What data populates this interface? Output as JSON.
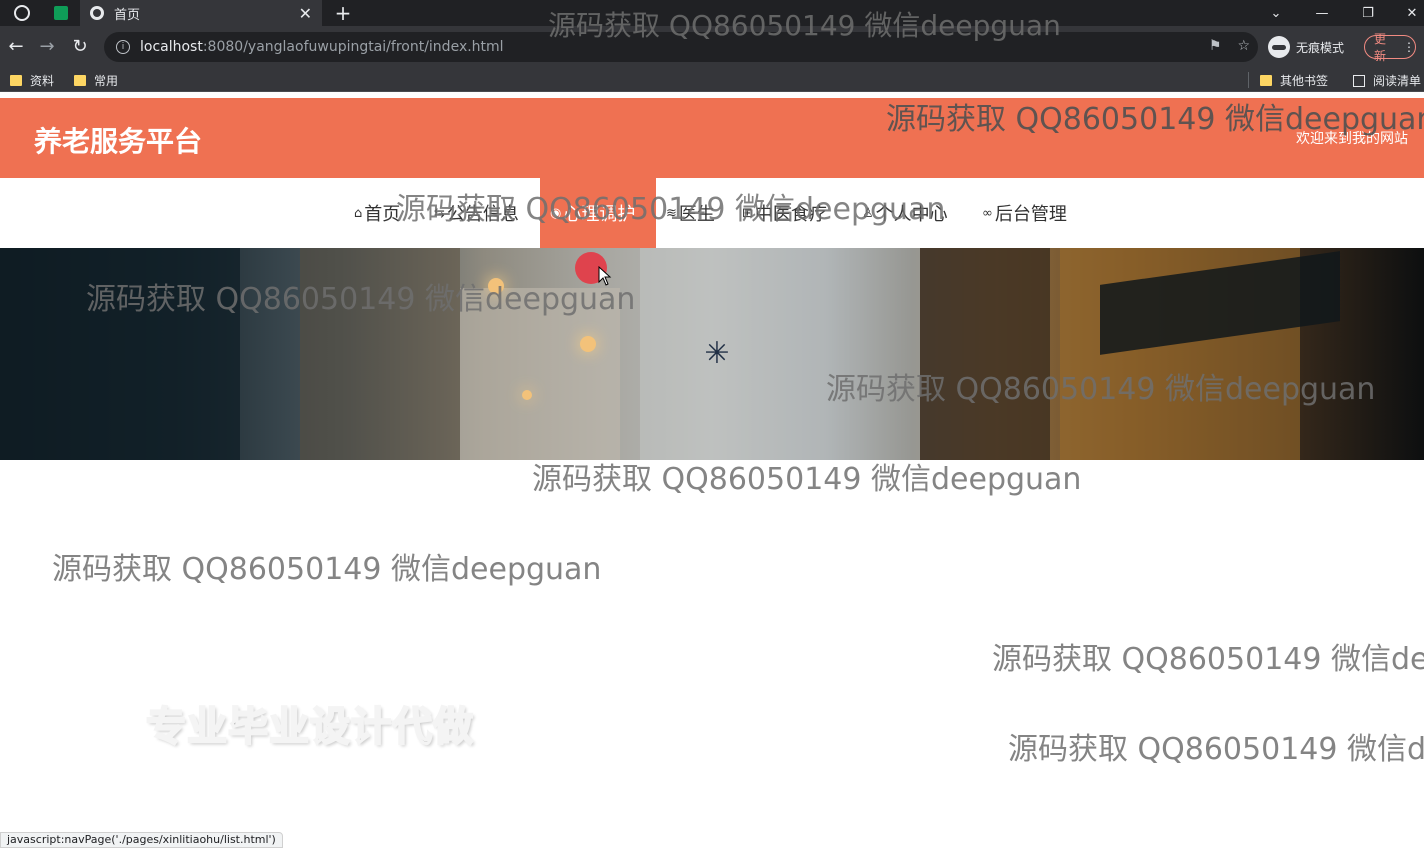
{
  "browser": {
    "tab_title": "首页",
    "tab_close": "✕",
    "new_tab": "+",
    "url_host": "localhost",
    "url_rest": ":8080/yanglaofuwupingtai/front/index.html",
    "incognito_label": "无痕模式",
    "update_label": "更新",
    "bookmarks": [
      "资料",
      "常用"
    ],
    "other_bookmarks": "其他书签",
    "reading_list": "阅读清单",
    "status_url": "javascript:navPage('./pages/xinlitiaohu/list.html')"
  },
  "site": {
    "title": "养老服务平台",
    "welcome": "欢迎来到我的网站",
    "nav": [
      {
        "label": "首页",
        "icon": "home-icon",
        "glyph": "⌂"
      },
      {
        "label": "公告信息",
        "icon": "notice-icon",
        "glyph": "⇆"
      },
      {
        "label": "心理调护",
        "icon": "heart-icon",
        "glyph": "◉"
      },
      {
        "label": "医生",
        "icon": "layers-icon",
        "glyph": "≋"
      },
      {
        "label": "中医食疗",
        "icon": "grid-icon",
        "glyph": "⊞"
      },
      {
        "label": "个人中心",
        "icon": "user-icon",
        "glyph": "♙"
      },
      {
        "label": "后台管理",
        "icon": "link-icon",
        "glyph": "∞"
      }
    ],
    "promo_text": "专业毕业设计代做"
  },
  "watermark_text": "源码获取 QQ86050149 微信deepguan",
  "colors": {
    "brand": "#ef7152",
    "chrome_dark": "#202124",
    "chrome_toolbar": "#35363a"
  }
}
